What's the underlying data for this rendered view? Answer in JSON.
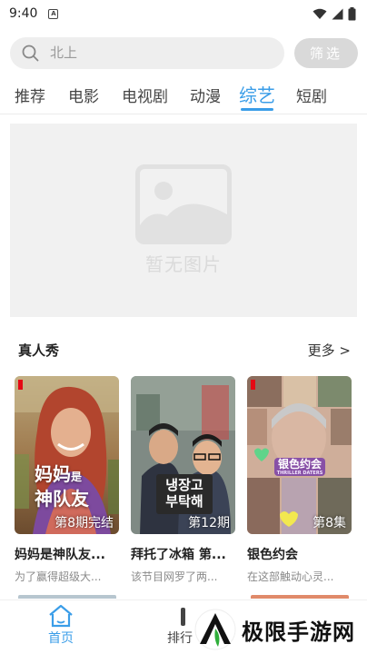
{
  "status_bar": {
    "time": "9:40",
    "notification_glyph": "A"
  },
  "search": {
    "placeholder": "北上",
    "filter_label": "筛选"
  },
  "tabs": [
    {
      "label": "推荐",
      "active": false
    },
    {
      "label": "电影",
      "active": false
    },
    {
      "label": "电视剧",
      "active": false
    },
    {
      "label": "动漫",
      "active": false
    },
    {
      "label": "综艺",
      "active": true
    },
    {
      "label": "短剧",
      "active": false
    }
  ],
  "banner": {
    "placeholder_text": "暂无图片",
    "icon": "image-placeholder-icon"
  },
  "section": {
    "title": "真人秀",
    "more_label": "更多 >"
  },
  "cards": [
    {
      "title": "妈妈是神队友...",
      "desc": "为了赢得超级大...",
      "badge": "第8期完结",
      "poster_text_line1": "妈妈",
      "poster_text_small": "是",
      "poster_text_line2": "神队友"
    },
    {
      "title": "拜托了冰箱 第...",
      "desc": "该节目网罗了两...",
      "badge": "第12期",
      "poster_text_line1": "냉장고",
      "poster_text_line2": "부탁해"
    },
    {
      "title": "银色约会",
      "desc": "在这部触动心灵...",
      "badge": "第8集",
      "poster_text_line1": "银色约会",
      "poster_text_line2": "THRILLER DATERS"
    }
  ],
  "bottom_nav": [
    {
      "label": "首页",
      "icon": "home-icon",
      "active": true
    },
    {
      "label": "排行",
      "icon": "ranking-icon",
      "active": false
    }
  ],
  "watermark": {
    "text": "极限手游网",
    "logo": "brand-logo-icon"
  },
  "colors": {
    "accent": "#3a9de8",
    "filter_button": "#d9d9d9",
    "search_bg": "#eeeeee",
    "banner_bg": "#f1f1f1"
  }
}
